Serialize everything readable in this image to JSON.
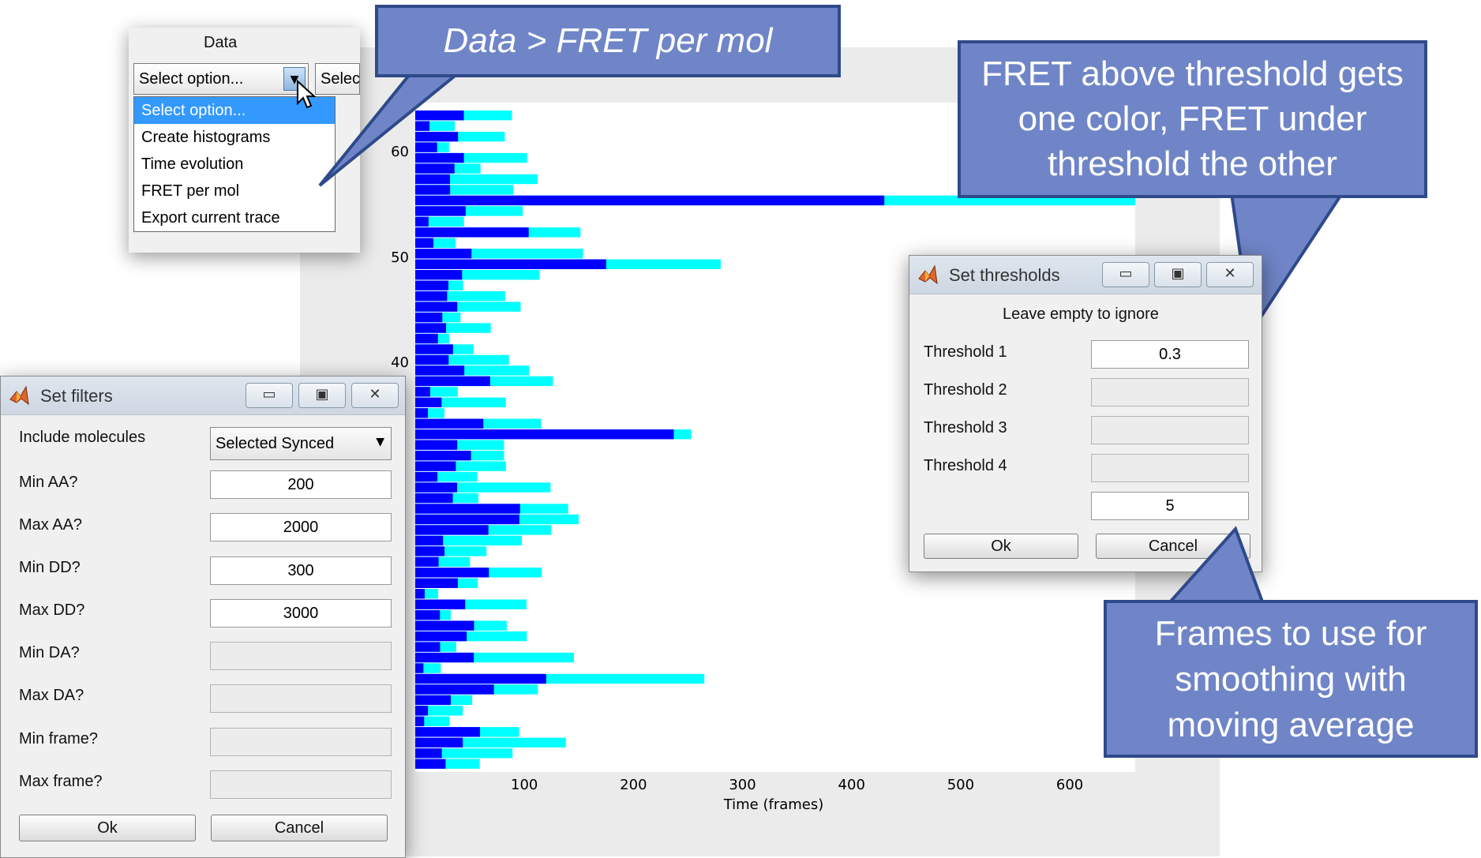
{
  "data_menu": {
    "header": "Data",
    "selected": "Select option...",
    "second_select": "Selec",
    "options": [
      "Select option...",
      "Create histograms",
      "Time evolution",
      "FRET per mol",
      "Export current trace"
    ]
  },
  "callouts": {
    "menu": "Data > FRET per mol",
    "threshold": "FRET above threshold gets one color, FRET under threshold the other",
    "smoothing": "Frames to use for smoothing with moving average"
  },
  "chart_data": {
    "type": "bar",
    "xlabel": "Time (frames)",
    "x_ticks": [
      "100",
      "200",
      "300",
      "400",
      "500",
      "600"
    ],
    "y_ticks": [
      "40",
      "50",
      "60"
    ],
    "xlim": [
      0,
      660
    ],
    "series": [
      {
        "color": "#0000ff",
        "label": "FRET above threshold"
      },
      {
        "color": "#00ffff",
        "label": "FRET below threshold"
      }
    ]
  },
  "set_filters": {
    "title": "Set filters",
    "include_label": "Include molecules",
    "include_value": "Selected Synced",
    "rows": [
      {
        "label": "Min AA?",
        "value": "200"
      },
      {
        "label": "Max AA?",
        "value": "2000"
      },
      {
        "label": "Min DD?",
        "value": "300"
      },
      {
        "label": "Max DD?",
        "value": "3000"
      },
      {
        "label": "Min DA?",
        "value": ""
      },
      {
        "label": "Max DA?",
        "value": ""
      },
      {
        "label": "Min frame?",
        "value": ""
      },
      {
        "label": "Max frame?",
        "value": ""
      }
    ],
    "ok": "Ok",
    "cancel": "Cancel"
  },
  "set_thresholds": {
    "title": "Set thresholds",
    "hint": "Leave empty to ignore",
    "rows": [
      {
        "label": "Threshold 1",
        "value": "0.3"
      },
      {
        "label": "Threshold 2",
        "value": ""
      },
      {
        "label": "Threshold 3",
        "value": ""
      },
      {
        "label": "Threshold 4",
        "value": ""
      }
    ],
    "smoothing_value": "5",
    "ok": "Ok",
    "cancel": "Cancel"
  },
  "colors": {
    "above": "#0000ff",
    "below": "#00ffff",
    "callout_fill": "#6f85c7",
    "callout_border": "#2f4a8a",
    "menu_highlight": "#3399ff"
  }
}
